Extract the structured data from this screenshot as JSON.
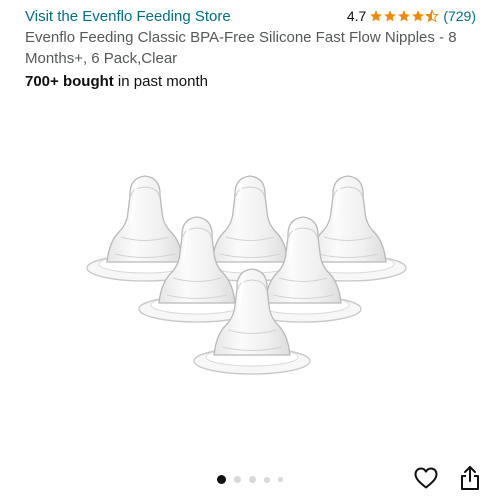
{
  "store": {
    "link_text": "Visit the Evenflo Feeding Store"
  },
  "rating": {
    "value": "4.7",
    "stars": 4.5,
    "count": "(729)",
    "star_color": "#f08804"
  },
  "product": {
    "title": "Evenflo Feeding Classic BPA-Free Silicone Fast Flow Nipples - 8 Months+, 6 Pack,Clear",
    "bought_bold": "700+ bought",
    "bought_rest": " in past month"
  },
  "gallery": {
    "total_images": 5,
    "current_index": 1
  },
  "icons": {
    "favorite": "heart-icon",
    "share": "share-icon"
  },
  "colors": {
    "link": "#007185",
    "secondary_text": "#565959",
    "dot_active": "#0f1111",
    "dot_inactive": "#d5d9d9"
  }
}
